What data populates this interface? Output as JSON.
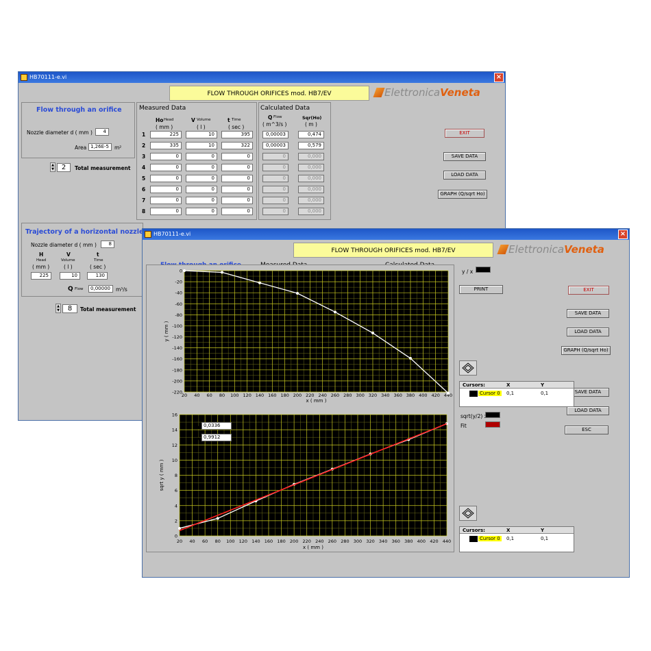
{
  "back_window": {
    "title": "HB70111-e.vi",
    "banner": "FLOW THROUGH ORIFICES mod. HB7/EV",
    "logo": {
      "part1": "Elettronica",
      "part2": "Veneta"
    },
    "orifice": {
      "title": "Flow through an orifice",
      "nozzle_label": "Nozzle diameter  d  ( mm )",
      "nozzle_value": "4",
      "area_label": "Area",
      "area_value": "1,26E-5",
      "area_unit": "m²",
      "total_value": "2",
      "total_label": "Total measurement"
    },
    "measured": {
      "title": "Measured Data",
      "h_head": "Ho",
      "h_head_small": "Head",
      "h_unit": "( mm )",
      "v_head": "V",
      "v_head_small": "Volume",
      "v_unit": "( l )",
      "t_head": "t",
      "t_head_small": "Time",
      "t_unit": "( sec )"
    },
    "calculated": {
      "title": "Calculated Data",
      "q_head": "Q",
      "q_head_small": "Flow",
      "q_unit": "( m^3/s )",
      "s_head": "Sqr(Ho)",
      "s_unit": "( m )"
    },
    "rows": [
      {
        "n": "1",
        "h": "225",
        "v": "10",
        "t": "395",
        "q": "0,00003",
        "s": "0,474"
      },
      {
        "n": "2",
        "h": "335",
        "v": "10",
        "t": "322",
        "q": "0,00003",
        "s": "0,579"
      },
      {
        "n": "3",
        "h": "0",
        "v": "0",
        "t": "0",
        "q": "0",
        "s": "0,000"
      },
      {
        "n": "4",
        "h": "0",
        "v": "0",
        "t": "0",
        "q": "0",
        "s": "0,000"
      },
      {
        "n": "5",
        "h": "0",
        "v": "0",
        "t": "0",
        "q": "0",
        "s": "0,000"
      },
      {
        "n": "6",
        "h": "0",
        "v": "0",
        "t": "0",
        "q": "0",
        "s": "0,000"
      },
      {
        "n": "7",
        "h": "0",
        "v": "0",
        "t": "0",
        "q": "0",
        "s": "0,000"
      },
      {
        "n": "8",
        "h": "0",
        "v": "0",
        "t": "0",
        "q": "0",
        "s": "0,000"
      }
    ],
    "buttons": {
      "exit": "EXIT",
      "save": "SAVE DATA",
      "load": "LOAD DATA",
      "graph": "GRAPH (Q/sqrt Ho)"
    },
    "trajectory": {
      "title": "Trajectory of a horizontal nozzle",
      "nozzle_label": "Nozzle diameter  d  ( mm )",
      "nozzle_value": "8",
      "h_head": "H",
      "h_small": "Head",
      "h_unit": "( mm )",
      "v_head": "V",
      "v_small": "Volume",
      "v_unit": "( l )",
      "t_head": "t",
      "t_small": "Time",
      "t_unit": "( sec )",
      "h_value": "225",
      "v_value": "10",
      "t_value": "130",
      "q_label": "Q",
      "q_small": "Flow",
      "q_value": "0,00000",
      "q_unit": "m³/s",
      "total_value": "8",
      "total_label": "Total measurement"
    }
  },
  "front_window": {
    "title": "HB70111-e.vi",
    "banner": "FLOW THROUGH ORIFICES mod. HB7/EV",
    "logo": {
      "part1": "Elettronica",
      "part2": "Veneta"
    },
    "partial_tabs": [
      "Flow through an orifice",
      "Measured Data",
      "Calculated Data"
    ],
    "plot1_legend": "y / x",
    "print": "PRINT",
    "buttons": {
      "exit": "EXIT",
      "save": "SAVE DATA",
      "load": "LOAD DATA",
      "graph": "GRAPH (Q/sqrt Ho)",
      "save2": "SAVE DATA",
      "load2": "LOAD DATA",
      "esc": "ESC"
    },
    "cursor1": {
      "h1": "Cursors:",
      "h2": "X",
      "h3": "Y",
      "name": "Cursor 0",
      "x": "0,1",
      "y": "0,1"
    },
    "cursor2": {
      "h1": "Cursors:",
      "h2": "X",
      "h3": "Y",
      "name": "Cursor 0",
      "x": "0,1",
      "y": "0,1"
    },
    "plot2_legend": {
      "series1": "sqrt(y/2) x",
      "series2": "Fit"
    },
    "fit": {
      "m_label": "m",
      "m_value": "0,0336",
      "cv_label": "cv",
      "cv_value": "0,9912"
    }
  },
  "chart_data": [
    {
      "type": "line",
      "xlabel": "x ( mm )",
      "ylabel": "y ( mm )",
      "xlim": [
        20,
        440
      ],
      "ylim": [
        -220,
        0
      ],
      "xticks": [
        20,
        40,
        60,
        80,
        100,
        120,
        140,
        160,
        180,
        200,
        220,
        240,
        260,
        280,
        300,
        320,
        340,
        360,
        380,
        400,
        420,
        440
      ],
      "yticks": [
        0,
        -20,
        -40,
        -60,
        -80,
        -100,
        -120,
        -140,
        -160,
        -180,
        -200,
        -220
      ],
      "grid": true,
      "background": "#000000",
      "series": [
        {
          "name": "y / x",
          "color": "#ffffff",
          "x": [
            20,
            80,
            140,
            200,
            260,
            320,
            380,
            440
          ],
          "y": [
            0,
            -3,
            -22,
            -41,
            -75,
            -113,
            -159,
            -222
          ]
        }
      ]
    },
    {
      "type": "line",
      "xlabel": "x ( mm )",
      "ylabel": "sqrt y ( mm )",
      "xlim": [
        20,
        440
      ],
      "ylim": [
        0,
        16
      ],
      "xticks": [
        20,
        40,
        60,
        80,
        100,
        120,
        140,
        160,
        180,
        200,
        220,
        240,
        260,
        280,
        300,
        320,
        340,
        360,
        380,
        400,
        420,
        440
      ],
      "yticks": [
        0,
        2,
        4,
        6,
        8,
        10,
        12,
        14,
        16
      ],
      "grid": true,
      "background": "#000000",
      "series": [
        {
          "name": "sqrt(y/2) x",
          "color": "#ffffff",
          "x": [
            20,
            80,
            140,
            200,
            260,
            320,
            380,
            440
          ],
          "y": [
            1.0,
            2.3,
            4.6,
            6.8,
            8.8,
            10.8,
            12.7,
            14.8
          ]
        },
        {
          "name": "Fit",
          "color": "#ff2020",
          "x": [
            20,
            440
          ],
          "y": [
            0.7,
            14.8
          ]
        }
      ]
    }
  ]
}
